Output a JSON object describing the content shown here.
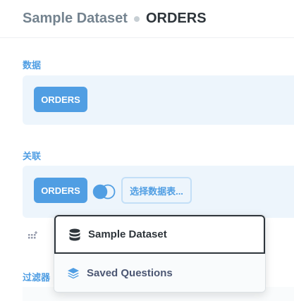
{
  "header": {
    "database": "Sample Dataset",
    "table": "ORDERS"
  },
  "data_section": {
    "label": "数据",
    "table_pill": "ORDERS"
  },
  "join_section": {
    "label": "关联",
    "left_table_pill": "ORDERS",
    "join_type_icon": "venn-left-join-icon",
    "pick_table_button": "选择数据表..."
  },
  "filter_section": {
    "label": "过滤器"
  },
  "popover": {
    "items": [
      {
        "label": "Sample Dataset",
        "icon": "database-icon"
      },
      {
        "label": "Saved Questions",
        "icon": "stacked-layers-icon"
      }
    ]
  },
  "colors": {
    "brand": "#509ee3",
    "step_bg": "#edf5fc",
    "text_dark": "#2e353b",
    "text_medium": "#74838f"
  }
}
